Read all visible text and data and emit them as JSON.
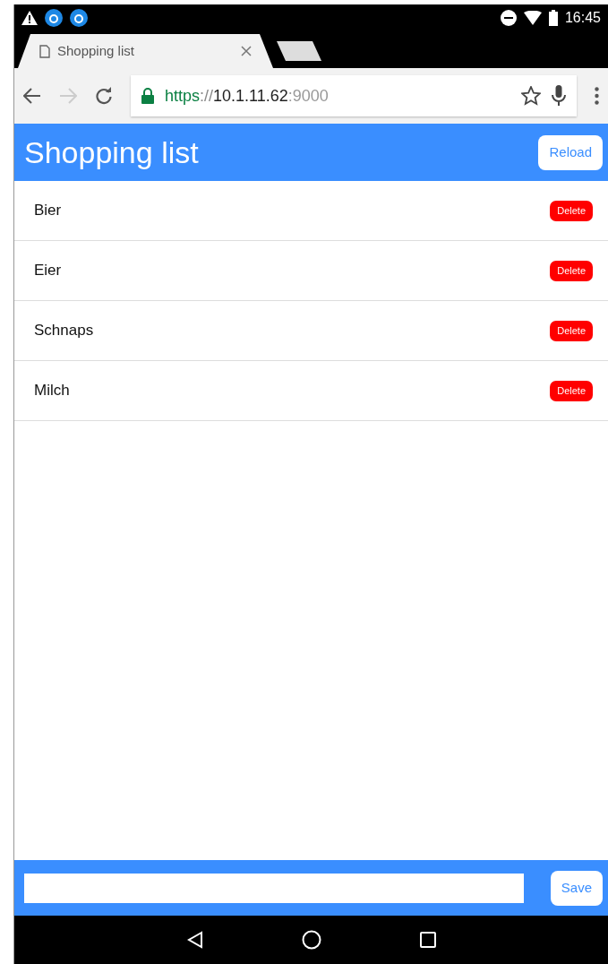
{
  "status_bar": {
    "time": "16:45"
  },
  "browser": {
    "tab": {
      "title": "Shopping list"
    },
    "url": {
      "scheme": "https",
      "separator": "://",
      "host": "10.1.11.62",
      "port": ":9000"
    },
    "forward_disabled": true
  },
  "app": {
    "title": "Shopping list",
    "reload_button": "Reload",
    "items": [
      {
        "name": "Bier",
        "delete_button": "Delete"
      },
      {
        "name": "Eier",
        "delete_button": "Delete"
      },
      {
        "name": "Schnaps",
        "delete_button": "Delete"
      },
      {
        "name": "Milch",
        "delete_button": "Delete"
      }
    ],
    "save_button": "Save"
  }
}
